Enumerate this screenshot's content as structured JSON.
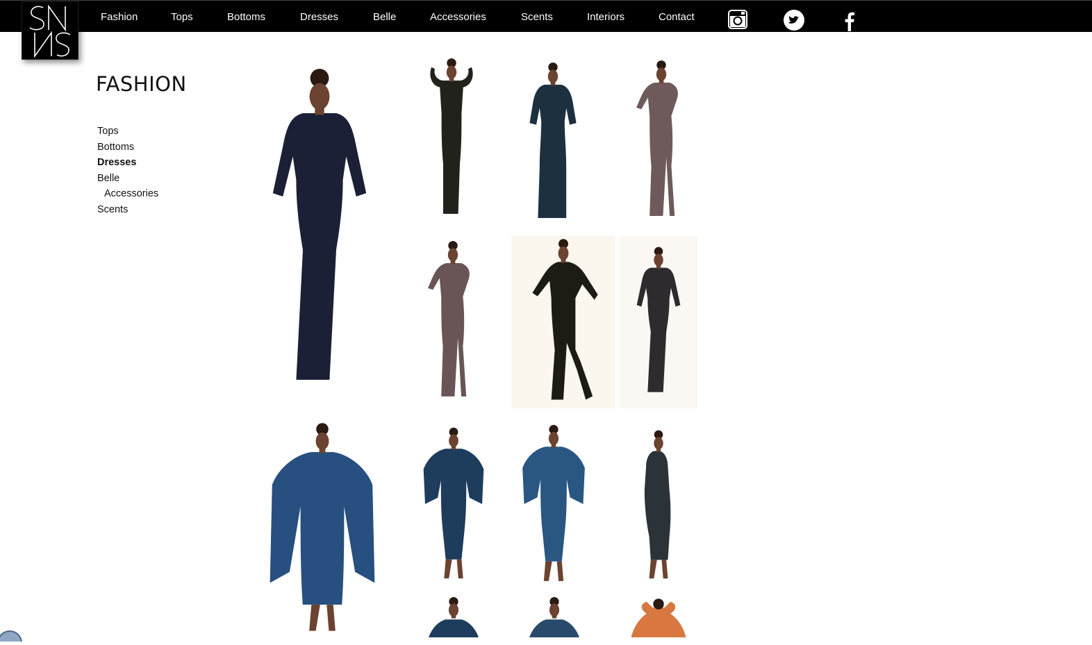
{
  "header": {
    "logo_text": "SNS",
    "nav": [
      {
        "label": "Fashion"
      },
      {
        "label": "Tops"
      },
      {
        "label": "Bottoms"
      },
      {
        "label": "Dresses"
      },
      {
        "label": "Belle"
      },
      {
        "label": "Accessories"
      },
      {
        "label": "Scents"
      },
      {
        "label": "Interiors"
      },
      {
        "label": "Contact"
      }
    ],
    "social": [
      "instagram-icon",
      "twitter-icon",
      "facebook-icon"
    ]
  },
  "sidebar": {
    "title": "FASHION",
    "items": [
      {
        "label": "Tops",
        "active": false
      },
      {
        "label": "Bottoms",
        "active": false
      },
      {
        "label": "Dresses",
        "active": true
      },
      {
        "label": "Belle",
        "active": false
      },
      {
        "label": "Accessories",
        "active": false
      },
      {
        "label": "Scents",
        "active": false
      }
    ]
  },
  "gallery": {
    "photos": [
      {
        "name": "photo-black-gown-front",
        "dress": "#1b2036",
        "bg": "#ffffff"
      },
      {
        "name": "photo-black-gown-arms-up",
        "dress": "#22221c",
        "bg": "#ffffff"
      },
      {
        "name": "photo-black-gown-back",
        "dress": "#1c3040",
        "bg": "#ffffff"
      },
      {
        "name": "photo-mauve-gown-pose",
        "dress": "#6e5a5a",
        "bg": "#ffffff"
      },
      {
        "name": "photo-mauve-gown-side",
        "dress": "#6a5556",
        "bg": "#ffffff"
      },
      {
        "name": "photo-black-gown-slit",
        "dress": "#1d1c14",
        "bg": "#fbf7ee"
      },
      {
        "name": "photo-dark-gown-hand-hip",
        "dress": "#2d2b2e",
        "bg": "#fbf7f2"
      },
      {
        "name": "photo-blue-cape-dress-front",
        "dress": "#274f7f",
        "bg": "#ffffff"
      },
      {
        "name": "photo-blue-cape-dress-a",
        "dress": "#1e3c5c",
        "bg": "#ffffff"
      },
      {
        "name": "photo-blue-cape-dress-b",
        "dress": "#2a5682",
        "bg": "#ffffff"
      },
      {
        "name": "photo-blue-cape-dress-back",
        "dress": "#2b3238",
        "bg": "#ffffff"
      },
      {
        "name": "photo-blue-dress-crop-1",
        "dress": "#1e3c5c",
        "bg": "#ffffff"
      },
      {
        "name": "photo-blue-dress-crop-2",
        "dress": "#2a4a6c",
        "bg": "#ffffff"
      },
      {
        "name": "photo-orange-top-crop",
        "dress": "#d87840",
        "bg": "#ffffff"
      }
    ]
  },
  "colors": {
    "nav_bg": "#000000",
    "nav_text": "#ffffff",
    "skin": "#6b4330",
    "hair": "#2a1a12"
  }
}
